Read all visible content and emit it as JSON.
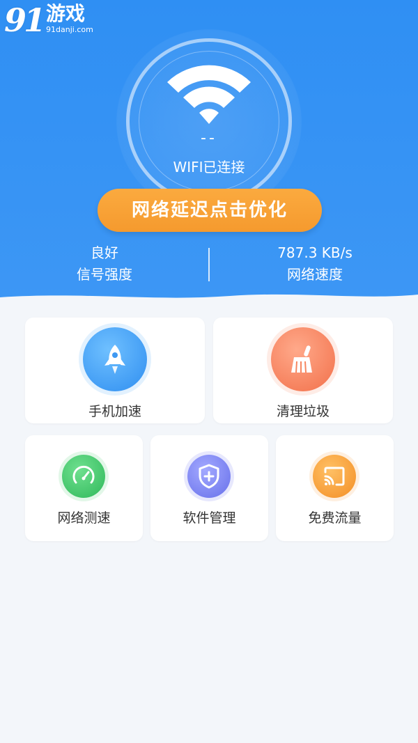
{
  "watermark": {
    "number": "91",
    "name": "游戏",
    "url": "91danji.com"
  },
  "status": {
    "dashes": "--",
    "label": "WIFI已连接"
  },
  "optimize_button": {
    "label": "网络延迟点击优化"
  },
  "stats": {
    "signal": {
      "value": "良好",
      "label": "信号强度"
    },
    "speed": {
      "value": "787.3 KB/s",
      "label": "网络速度"
    }
  },
  "features": {
    "phone_boost": {
      "label": "手机加速",
      "icon": "rocket-icon",
      "color": "#3aa0f3"
    },
    "clean_trash": {
      "label": "清理垃圾",
      "icon": "broom-icon",
      "color": "#f47e56"
    },
    "speed_test": {
      "label": "网络测速",
      "icon": "speedometer-icon",
      "color": "#38c46a"
    },
    "app_manage": {
      "label": "软件管理",
      "icon": "shield-plus-icon",
      "color": "#7a82f0"
    },
    "free_data": {
      "label": "免费流量",
      "icon": "cast-icon",
      "color": "#f5952e"
    }
  },
  "colors": {
    "header": "#3a95f4",
    "button": "#f7a236",
    "background": "#f3f6fa"
  }
}
